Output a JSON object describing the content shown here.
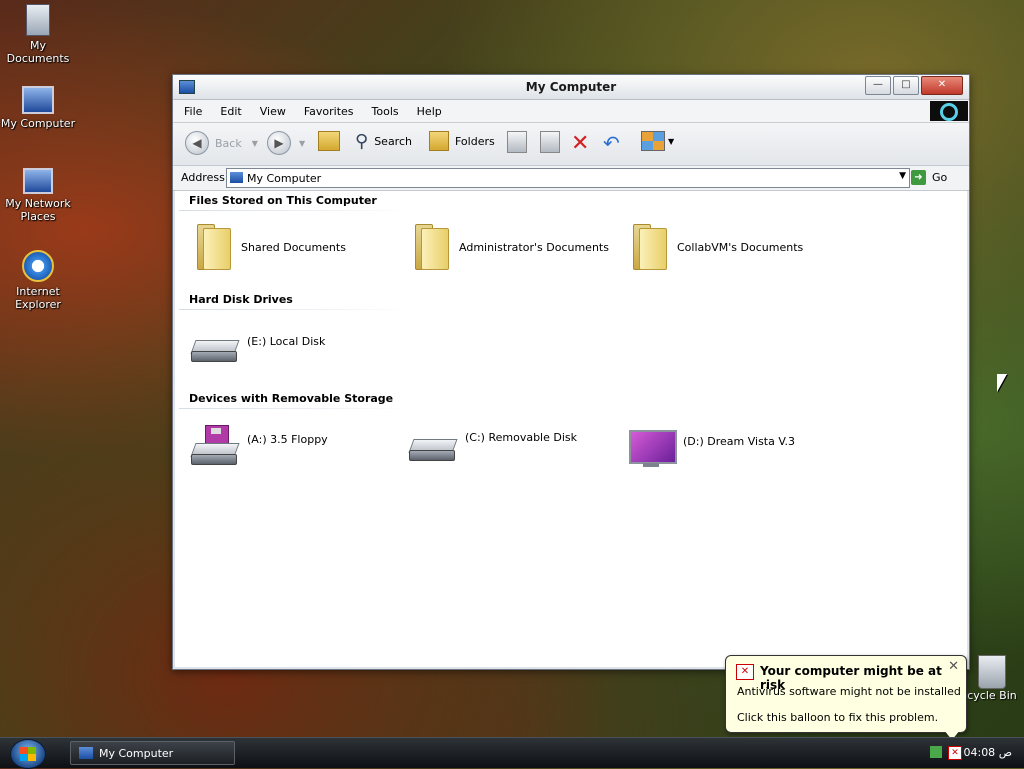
{
  "desktop": {
    "icons": [
      {
        "label": "My Documents"
      },
      {
        "label": "My Computer"
      },
      {
        "label": "My Network\nPlaces"
      },
      {
        "label": "Internet\nExplorer"
      }
    ],
    "recycle_bin_label": "cycle Bin"
  },
  "window": {
    "title": "My Computer",
    "menu": [
      "File",
      "Edit",
      "View",
      "Favorites",
      "Tools",
      "Help"
    ],
    "toolbar": {
      "back_label": "Back",
      "search_label": "Search",
      "folders_label": "Folders"
    },
    "address": {
      "label": "Address",
      "value": "My Computer",
      "go_label": "Go"
    },
    "sections": [
      {
        "title": "Files Stored on This Computer",
        "items": [
          {
            "label": "Shared Documents",
            "icon": "folder-icon"
          },
          {
            "label": "Administrator's Documents",
            "icon": "folder-icon"
          },
          {
            "label": "CollabVM's Documents",
            "icon": "folder-icon"
          }
        ]
      },
      {
        "title": "Hard Disk Drives",
        "items": [
          {
            "label": "(E:) Local Disk",
            "icon": "hard-drive-icon"
          }
        ]
      },
      {
        "title": "Devices with Removable Storage",
        "items": [
          {
            "label": "(A:) 3.5 Floppy",
            "icon": "floppy-drive-icon"
          },
          {
            "label": "(C:) Removable Disk",
            "icon": "removable-disk-icon"
          },
          {
            "label": "(D:) Dream Vista V.3",
            "icon": "cd-drive-icon"
          }
        ]
      }
    ]
  },
  "taskbar": {
    "task_label": "My Computer",
    "clock": "04:08 ص"
  },
  "balloon": {
    "title": "Your computer might be at risk",
    "line1": "Antivirus software might not be installed",
    "line2": "Click this balloon to fix this problem."
  }
}
